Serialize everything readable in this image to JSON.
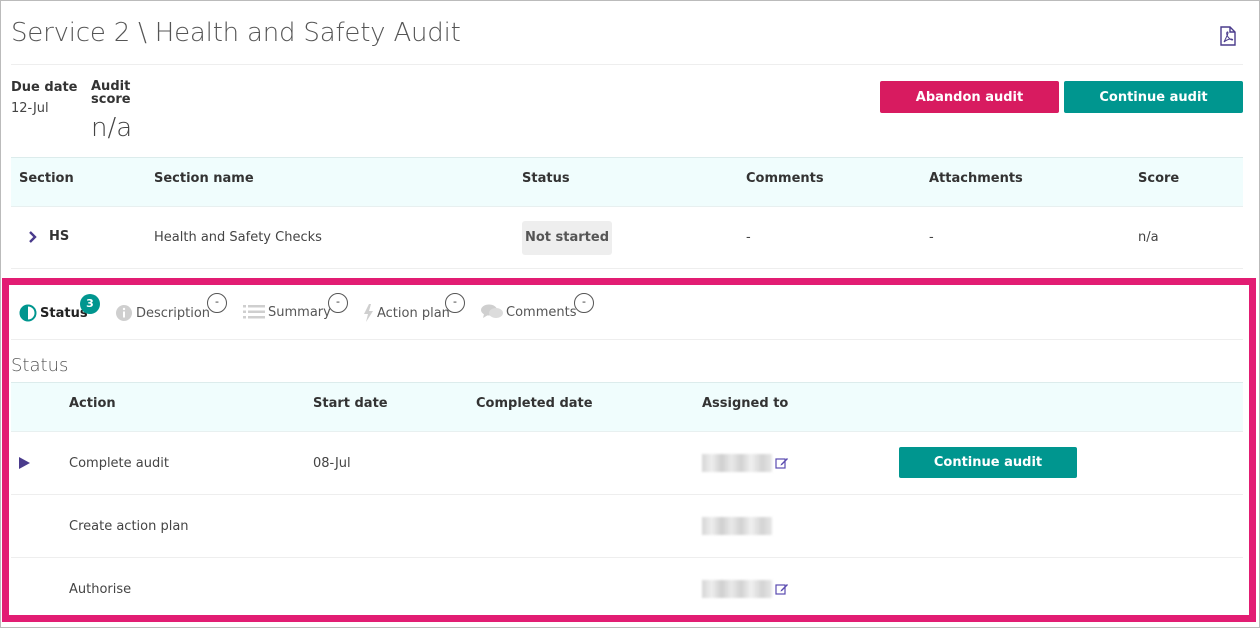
{
  "header": {
    "title": "Service 2 \\ Health and Safety Audit",
    "pdf_icon": "pdf-file-icon"
  },
  "meta": {
    "due_date_label": "Due date",
    "due_date_value": "12-Jul",
    "audit_score_label": "Audit score",
    "audit_score_value": "n/a"
  },
  "buttons": {
    "abandon": "Abandon audit",
    "continue": "Continue audit"
  },
  "sections_table": {
    "columns": [
      "Section",
      "Section name",
      "Status",
      "Comments",
      "Attachments",
      "Score"
    ],
    "rows": [
      {
        "section": "HS",
        "name": "Health and Safety Checks",
        "status": "Not started",
        "comments": "-",
        "attachments": "-",
        "score": "n/a"
      }
    ]
  },
  "tabs": [
    {
      "label": "Status",
      "badge": "3",
      "icon": "half-circle-icon"
    },
    {
      "label": "Description",
      "badge": "-",
      "icon": "info-icon"
    },
    {
      "label": "Summary",
      "badge": "-",
      "icon": "list-icon"
    },
    {
      "label": "Action plan",
      "badge": "-",
      "icon": "lightning-icon"
    },
    {
      "label": "Comments",
      "badge": "-",
      "icon": "chat-bubbles-icon"
    }
  ],
  "status_panel": {
    "heading": "Status",
    "columns": [
      "Action",
      "Start date",
      "Completed date",
      "Assigned to"
    ],
    "rows": [
      {
        "action": "Complete audit",
        "start_date": "08-Jul",
        "completed_date": "",
        "button": "Continue audit"
      },
      {
        "action": "Create action plan",
        "start_date": "",
        "completed_date": ""
      },
      {
        "action": "Authorise",
        "start_date": "",
        "completed_date": ""
      }
    ]
  },
  "colors": {
    "accent_teal": "#00968f",
    "accent_pink": "#d81b60",
    "highlight_border": "#e21d73",
    "header_bg": "#f0fdfd",
    "chevron_purple": "#4a3b8c"
  }
}
